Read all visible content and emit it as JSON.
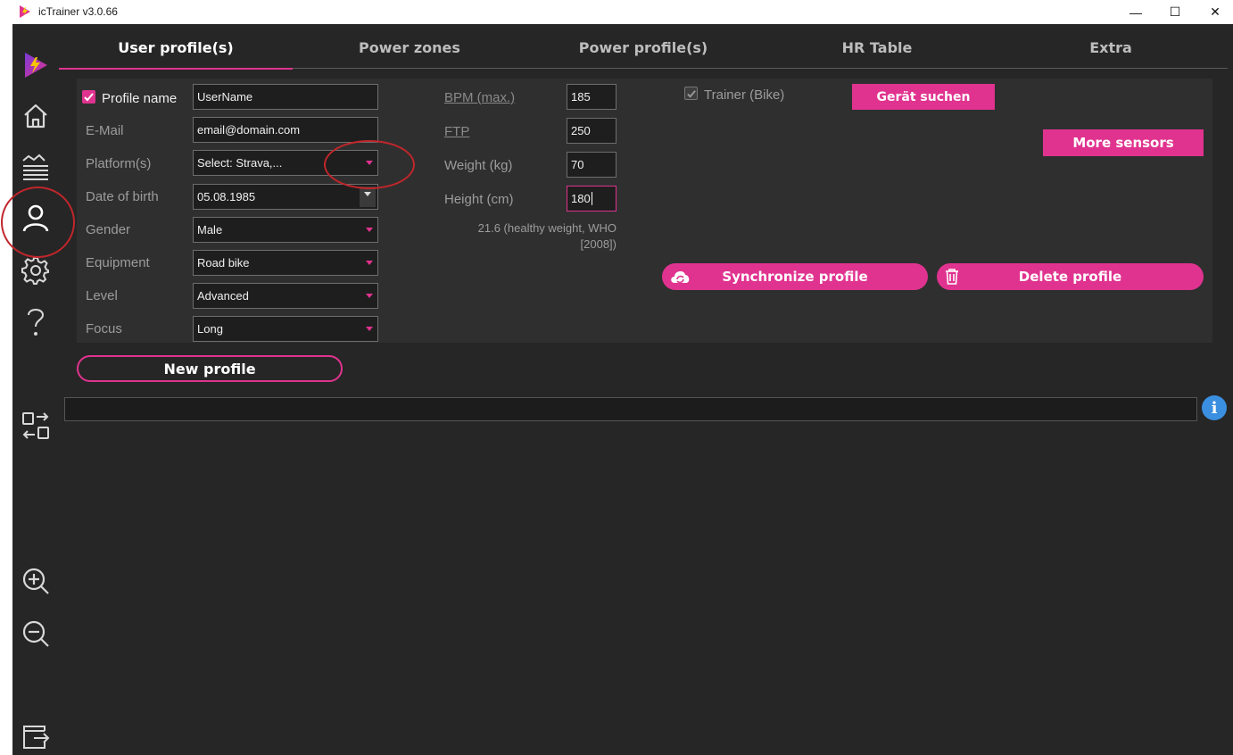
{
  "window": {
    "title": "icTrainer v3.0.66",
    "controls": {
      "minimize": "—",
      "maximize": "☐",
      "close": "✕"
    }
  },
  "tabs": [
    {
      "label": "User profile(s)",
      "active": true
    },
    {
      "label": "Power zones",
      "active": false
    },
    {
      "label": "Power profile(s)",
      "active": false
    },
    {
      "label": "HR Table",
      "active": false
    },
    {
      "label": "Extra",
      "active": false
    }
  ],
  "profile": {
    "profile_name": {
      "label": "Profile name",
      "value": "UserName",
      "checked": true
    },
    "email": {
      "label": "E-Mail",
      "value": "email@domain.com"
    },
    "platforms": {
      "label": "Platform(s)",
      "value": "Select: Strava,..."
    },
    "dob": {
      "label": "Date of birth",
      "value": "05.08.1985"
    },
    "gender": {
      "label": "Gender",
      "value": "Male"
    },
    "equipment": {
      "label": "Equipment",
      "value": "Road bike"
    },
    "level": {
      "label": "Level",
      "value": "Advanced"
    },
    "focus": {
      "label": "Focus",
      "value": "Long"
    }
  },
  "metrics": {
    "bpm": {
      "label": "BPM (max.)",
      "value": "185"
    },
    "ftp": {
      "label": "FTP",
      "value": "250"
    },
    "weight": {
      "label": "Weight (kg)",
      "value": "70"
    },
    "height": {
      "label": "Height (cm)",
      "value": "180"
    },
    "bmi_line1": "21.6 (healthy weight, WHO",
    "bmi_line2": "[2008])"
  },
  "sensors": {
    "trainer_label": "Trainer (Bike)",
    "trainer_checked": true,
    "search_button": "Gerät suchen",
    "more_sensors_button": "More sensors"
  },
  "actions": {
    "sync_button": "Synchronize profile",
    "delete_button": "Delete profile",
    "new_profile_button": "New profile"
  },
  "status": {
    "info_icon_glyph": "i"
  },
  "colors": {
    "accent": "#e0338f",
    "background": "#262626",
    "panel": "#2f2f2f",
    "info": "#3b8fe0",
    "annotation": "#c0262b"
  }
}
